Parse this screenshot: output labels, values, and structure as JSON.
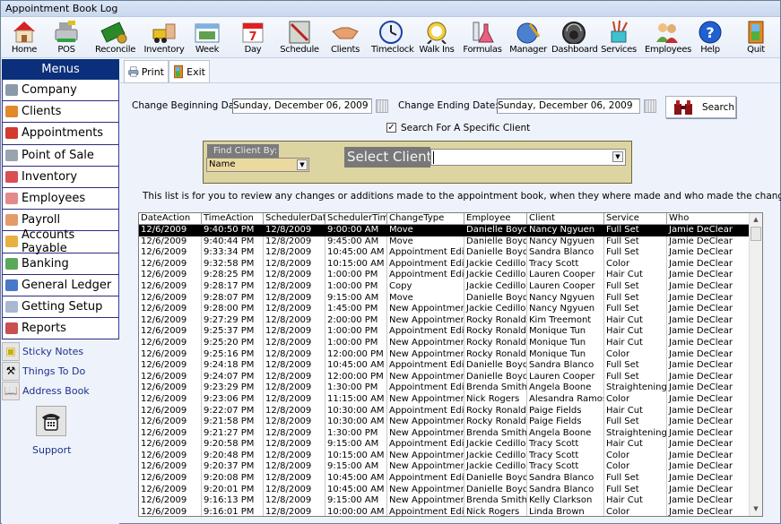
{
  "window": {
    "title": "Appointment Book Log"
  },
  "toolbar": {
    "items": [
      {
        "label": "Home",
        "icon": "house-icon"
      },
      {
        "label": "POS",
        "icon": "cash-register-icon"
      },
      {
        "label": "Reconcile",
        "icon": "money-icon"
      },
      {
        "label": "Inventory",
        "icon": "forklift-icon"
      },
      {
        "label": "Week",
        "icon": "week-calendar-icon"
      },
      {
        "label": "Day",
        "icon": "day-calendar-icon"
      },
      {
        "label": "Schedule",
        "icon": "schedule-chart-icon"
      },
      {
        "label": "Clients",
        "icon": "handshake-icon"
      },
      {
        "label": "Timeclock",
        "icon": "clock-icon"
      },
      {
        "label": "Walk Ins",
        "icon": "walking-clock-icon"
      },
      {
        "label": "Formulas",
        "icon": "flask-icon"
      },
      {
        "label": "Manager",
        "icon": "globe-key-icon"
      },
      {
        "label": "Dashboard",
        "icon": "gauge-icon"
      },
      {
        "label": "Services",
        "icon": "tools-cup-icon"
      },
      {
        "label": "Employees",
        "icon": "people-icon"
      },
      {
        "label": "Help",
        "icon": "help-icon"
      },
      {
        "label": "Quit",
        "icon": "door-icon"
      }
    ]
  },
  "sidebar": {
    "header": "Menus",
    "items": [
      {
        "label": "Company",
        "color": "#8a9aa8"
      },
      {
        "label": "Clients",
        "color": "#e08a2a"
      },
      {
        "label": "Appointments",
        "color": "#d23b2b"
      },
      {
        "label": "Point of Sale",
        "color": "#9aa4ae"
      },
      {
        "label": "Inventory",
        "color": "#d8504f"
      },
      {
        "label": "Employees",
        "color": "#e48a8a"
      },
      {
        "label": "Payroll",
        "color": "#e49a6a"
      },
      {
        "label": "Accounts Payable",
        "color": "#e8b040"
      },
      {
        "label": "Banking",
        "color": "#5aa85a"
      },
      {
        "label": "General Ledger",
        "color": "#4a78c8"
      },
      {
        "label": "Getting Setup",
        "color": "#a8b8d0"
      },
      {
        "label": "Reports",
        "color": "#c85050"
      }
    ],
    "quick_links": [
      {
        "label": "Sticky Notes",
        "icon": "sticky-notes-icon"
      },
      {
        "label": "Things To Do",
        "icon": "hammer-icon"
      },
      {
        "label": "Address Book",
        "icon": "address-book-icon"
      }
    ],
    "support_label": "Support"
  },
  "actions": {
    "print": "Print",
    "exit": "Exit"
  },
  "filters": {
    "begin_label": "Change Beginning Date:",
    "begin_value": "Sunday, December 06, 2009",
    "end_label": "Change Ending Date:",
    "end_value": "Sunday, December 06, 2009",
    "search_label": "Search",
    "specific_client_label": "Search For A Specific Client",
    "specific_client_checked": true,
    "find_by_label": "Find Client By:",
    "find_by_value": "Name",
    "select_client_label": "Select Client :",
    "select_client_value": ""
  },
  "info_text": "This list is for you to review any changes or additions made to the appointment book, when they where made and who made the changes.",
  "grid": {
    "columns": [
      "DateAction",
      "TimeAction",
      "SchedulerDate",
      "SchedulerTime",
      "ChangeType",
      "Employee",
      "Client",
      "Service",
      "Who"
    ],
    "selected_row": 0,
    "rows": [
      [
        "12/6/2009",
        "9:40:50 PM",
        "12/8/2009",
        "9:00:00 AM",
        "Move",
        "Danielle Boyd",
        "Nancy Ngyuen",
        "Full Set",
        "Jamie DeClear"
      ],
      [
        "12/6/2009",
        "9:40:44 PM",
        "12/8/2009",
        "9:45:00 AM",
        "Move",
        "Danielle Boyd",
        "Nancy Ngyuen",
        "Full Set",
        "Jamie DeClear"
      ],
      [
        "12/6/2009",
        "9:33:34 PM",
        "12/8/2009",
        "10:45:00 AM",
        "Appointment Edit",
        "Danielle Boyd",
        "Sandra Blanco",
        "Full Set",
        "Jamie DeClear"
      ],
      [
        "12/6/2009",
        "9:32:58 PM",
        "12/8/2009",
        "10:15:00 AM",
        "Appointment Edit",
        "Jackie Cedillo",
        "Tracy Scott",
        "Color",
        "Jamie DeClear"
      ],
      [
        "12/6/2009",
        "9:28:25 PM",
        "12/8/2009",
        "1:00:00 PM",
        "Appointment Edit",
        "Jackie Cedillo",
        "Lauren Cooper",
        "Hair Cut",
        "Jamie DeClear"
      ],
      [
        "12/6/2009",
        "9:28:17 PM",
        "12/8/2009",
        "1:00:00 PM",
        "Copy",
        "Jackie Cedillo",
        "Lauren Cooper",
        "Full Set",
        "Jamie DeClear"
      ],
      [
        "12/6/2009",
        "9:28:07 PM",
        "12/8/2009",
        "9:15:00 AM",
        "Move",
        "Danielle Boyd",
        "Nancy Ngyuen",
        "Full Set",
        "Jamie DeClear"
      ],
      [
        "12/6/2009",
        "9:28:00 PM",
        "12/8/2009",
        "1:45:00 PM",
        "New Appointment",
        "Jackie Cedillo",
        "Nancy Ngyuen",
        "Full Set",
        "Jamie DeClear"
      ],
      [
        "12/6/2009",
        "9:27:29 PM",
        "12/8/2009",
        "2:00:00 PM",
        "New Appointment",
        "Rocky Ronald",
        "Kim Treemont",
        "Hair Cut",
        "Jamie DeClear"
      ],
      [
        "12/6/2009",
        "9:25:37 PM",
        "12/8/2009",
        "1:00:00 PM",
        "Appointment Edit",
        "Rocky Ronald",
        "Monique Tun",
        "Hair Cut",
        "Jamie DeClear"
      ],
      [
        "12/6/2009",
        "9:25:20 PM",
        "12/8/2009",
        "1:00:00 PM",
        "New Appointment",
        "Rocky Ronald",
        "Monique Tun",
        "Hair Cut",
        "Jamie DeClear"
      ],
      [
        "12/6/2009",
        "9:25:16 PM",
        "12/8/2009",
        "12:00:00 PM",
        "New Appointment",
        "Rocky Ronald",
        "Monique Tun",
        "Color",
        "Jamie DeClear"
      ],
      [
        "12/6/2009",
        "9:24:18 PM",
        "12/8/2009",
        "10:45:00 AM",
        "Appointment Edit",
        "Danielle Boyd",
        "Sandra Blanco",
        "Full Set",
        "Jamie DeClear"
      ],
      [
        "12/6/2009",
        "9:24:07 PM",
        "12/8/2009",
        "12:00:00 PM",
        "New Appointment",
        "Danielle Boyd",
        "Lauren Cooper",
        "Full Set",
        "Jamie DeClear"
      ],
      [
        "12/6/2009",
        "9:23:29 PM",
        "12/8/2009",
        "1:30:00 PM",
        "Appointment Edit",
        "Brenda Smith",
        "Angela Boone",
        "Straightening",
        "Jamie DeClear"
      ],
      [
        "12/6/2009",
        "9:23:06 PM",
        "12/8/2009",
        "11:15:00 AM",
        "New Appointment",
        "Nick Rogers",
        "Alesandra Ramos",
        "Color",
        "Jamie DeClear"
      ],
      [
        "12/6/2009",
        "9:22:07 PM",
        "12/8/2009",
        "10:30:00 AM",
        "Appointment Edit",
        "Rocky Ronald",
        "Paige Fields",
        "Hair Cut",
        "Jamie DeClear"
      ],
      [
        "12/6/2009",
        "9:21:58 PM",
        "12/8/2009",
        "10:30:00 AM",
        "New Appointment",
        "Rocky Ronald",
        "Paige Fields",
        "Full Set",
        "Jamie DeClear"
      ],
      [
        "12/6/2009",
        "9:21:27 PM",
        "12/8/2009",
        "1:30:00 PM",
        "New Appointment",
        "Brenda Smith",
        "Angela Boone",
        "Straightening",
        "Jamie DeClear"
      ],
      [
        "12/6/2009",
        "9:20:58 PM",
        "12/8/2009",
        "9:15:00 AM",
        "Appointment Edit",
        "Jackie Cedillo",
        "Tracy Scott",
        "Hair Cut",
        "Jamie DeClear"
      ],
      [
        "12/6/2009",
        "9:20:48 PM",
        "12/8/2009",
        "10:15:00 AM",
        "New Appointment",
        "Jackie Cedillo",
        "Tracy Scott",
        "Color",
        "Jamie DeClear"
      ],
      [
        "12/6/2009",
        "9:20:37 PM",
        "12/8/2009",
        "9:15:00 AM",
        "New Appointment",
        "Jackie Cedillo",
        "Tracy Scott",
        "Color",
        "Jamie DeClear"
      ],
      [
        "12/6/2009",
        "9:20:08 PM",
        "12/8/2009",
        "10:45:00 AM",
        "Appointment Edit",
        "Danielle Boyd",
        "Sandra Blanco",
        "Full Set",
        "Jamie DeClear"
      ],
      [
        "12/6/2009",
        "9:20:01 PM",
        "12/8/2009",
        "10:45:00 AM",
        "New Appointment",
        "Danielle Boyd",
        "Sandra Blanco",
        "Full Set",
        "Jamie DeClear"
      ],
      [
        "12/6/2009",
        "9:16:13 PM",
        "12/8/2009",
        "9:15:00 AM",
        "New Appointment",
        "Brenda Smith",
        "Kelly Clarkson",
        "Hair Cut",
        "Jamie DeClear"
      ],
      [
        "12/6/2009",
        "9:16:01 PM",
        "12/8/2009",
        "10:00:00 AM",
        "Appointment Edit",
        "Nick Rogers",
        "Linda Brown",
        "Color",
        "Jamie DeClear"
      ]
    ]
  }
}
